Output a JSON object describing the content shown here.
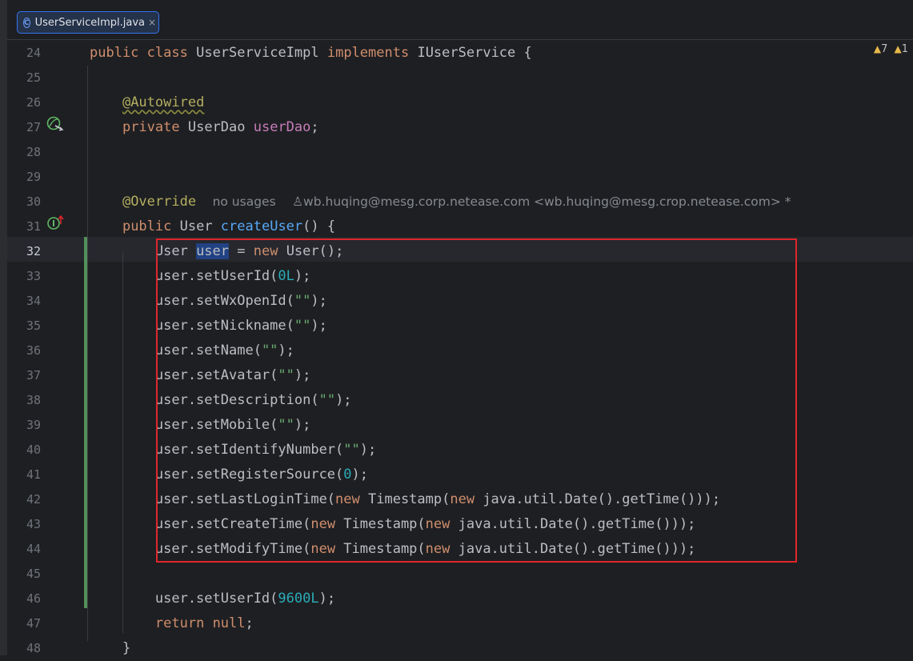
{
  "tab": {
    "title": "UserServiceImpl.java",
    "icon": "class-icon",
    "icon_glyph": "C",
    "close": "×"
  },
  "inspections": {
    "warnings": "7",
    "weak_warnings": "1",
    "icon": "warning-icon"
  },
  "hints": {
    "usages": "no usages",
    "author": "wb.huqing@mesg.corp.netease.com <wb.huqing@mesg.crop.netease.com> *",
    "author_icon": "person-icon"
  },
  "lines": [
    {
      "n": "24",
      "t": "public class UserServiceImpl implements IUserService {"
    },
    {
      "n": "25",
      "t": ""
    },
    {
      "n": "26",
      "t": "    @Autowired"
    },
    {
      "n": "27",
      "t": "    private UserDao userDao;"
    },
    {
      "n": "28",
      "t": ""
    },
    {
      "n": "29",
      "t": ""
    },
    {
      "n": "30",
      "t": "    @Override"
    },
    {
      "n": "31",
      "t": "    public User createUser() {"
    },
    {
      "n": "32",
      "t": "        User user = new User();"
    },
    {
      "n": "33",
      "t": "        user.setUserId(0L);"
    },
    {
      "n": "34",
      "t": "        user.setWxOpenId(\"\");"
    },
    {
      "n": "35",
      "t": "        user.setNickname(\"\");"
    },
    {
      "n": "36",
      "t": "        user.setName(\"\");"
    },
    {
      "n": "37",
      "t": "        user.setAvatar(\"\");"
    },
    {
      "n": "38",
      "t": "        user.setDescription(\"\");"
    },
    {
      "n": "39",
      "t": "        user.setMobile(\"\");"
    },
    {
      "n": "40",
      "t": "        user.setIdentifyNumber(\"\");"
    },
    {
      "n": "41",
      "t": "        user.setRegisterSource(0);"
    },
    {
      "n": "42",
      "t": "        user.setLastLoginTime(new Timestamp(new java.util.Date().getTime()));"
    },
    {
      "n": "43",
      "t": "        user.setCreateTime(new Timestamp(new java.util.Date().getTime()));"
    },
    {
      "n": "44",
      "t": "        user.setModifyTime(new Timestamp(new java.util.Date().getTime()));"
    },
    {
      "n": "45",
      "t": ""
    },
    {
      "n": "46",
      "t": "        user.setUserId(9600L);"
    },
    {
      "n": "47",
      "t": "        return null;"
    },
    {
      "n": "48",
      "t": "    }"
    }
  ],
  "gutter_icons": {
    "line27": "spring-bean-icon",
    "line31": "implements-method-icon"
  },
  "colors": {
    "keyword": "#cf8e6d",
    "annotation": "#b3ae60",
    "field": "#c77dbb",
    "method": "#56a8f5",
    "number": "#2aacb8",
    "string": "#6aab73",
    "highlight": "#e0262b",
    "vcs_modified": "#549159"
  }
}
